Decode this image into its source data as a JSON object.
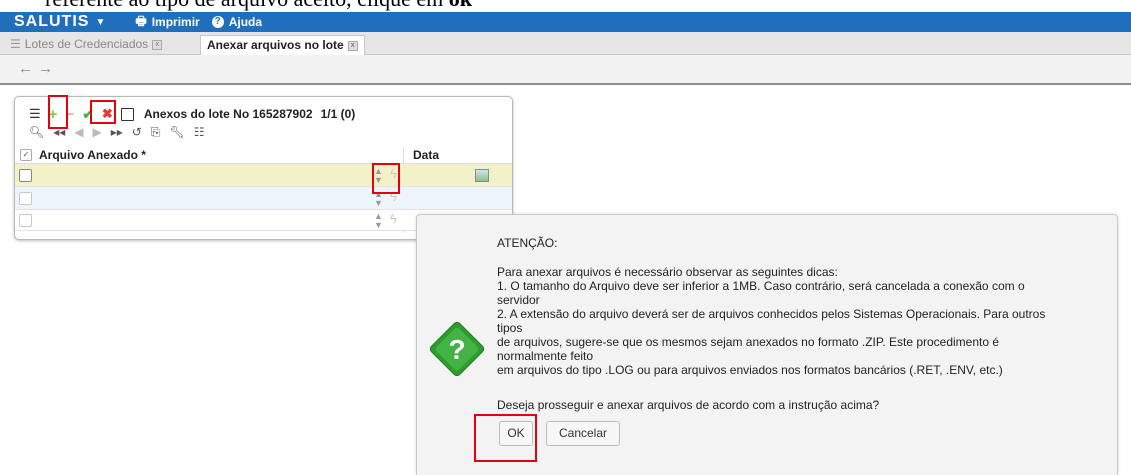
{
  "caption": {
    "text": "referente ao tipo de arquivo aceito, clique em",
    "bold": "ok"
  },
  "topbar": {
    "brand": "SALUTIS",
    "caret_icon": "caret-down-icon",
    "print_label": "Imprimir",
    "help_label": "Ajuda",
    "bg_color": "#1f6fbd"
  },
  "tabs": [
    {
      "label": "Lotes de Credenciados",
      "active": false
    },
    {
      "label": "Anexar arquivos no lote",
      "active": true
    }
  ],
  "nav": {
    "back_icon": "arrow-left-icon",
    "forward_icon": "arrow-right-icon"
  },
  "panel": {
    "title": "Anexos do lote No 165287902",
    "count": "1/1 (0)",
    "columns": [
      "Arquivo Anexado *",
      "Data"
    ],
    "rows": [
      {
        "file": "",
        "date": "",
        "selected": true
      },
      {
        "file": "",
        "date": "",
        "selected": false
      },
      {
        "file": "",
        "date": "",
        "selected": false
      }
    ],
    "toolbar_icons": [
      "list-icon",
      "add-icon",
      "remove-icon",
      "confirm-icon",
      "cancel-icon",
      "form-icon"
    ],
    "toolbar2_icons": [
      "search-icon",
      "first-icon",
      "prev-icon",
      "next-icon",
      "last-icon",
      "refresh-icon",
      "export-icon",
      "tool-icon",
      "list-detail-icon"
    ]
  },
  "dialog": {
    "heading": "ATENÇÃO:",
    "lines": [
      "Para anexar arquivos é necessário observar as seguintes dicas:",
      "1. O tamanho do Arquivo deve ser inferior a 1MB. Caso contrário, será cancelada a conexão com o",
      "servidor",
      "2. A extensão do arquivo deverá ser de arquivos conhecidos pelos Sistemas Operacionais. Para outros",
      "tipos",
      "de arquivos, sugere-se que os mesmos sejam anexados no formato .ZIP. Este procedimento é",
      "normalmente feito",
      "em arquivos do tipo .LOG ou para arquivos enviados nos formatos bancários (.RET, .ENV, etc.)"
    ],
    "question": "Deseja prosseguir e anexar arquivos de acordo com a instrução acima?",
    "ok_label": "OK",
    "cancel_label": "Cancelar",
    "icon": "question-icon",
    "icon_color": "#2e9d2e"
  },
  "highlight_color": "#e4000f"
}
